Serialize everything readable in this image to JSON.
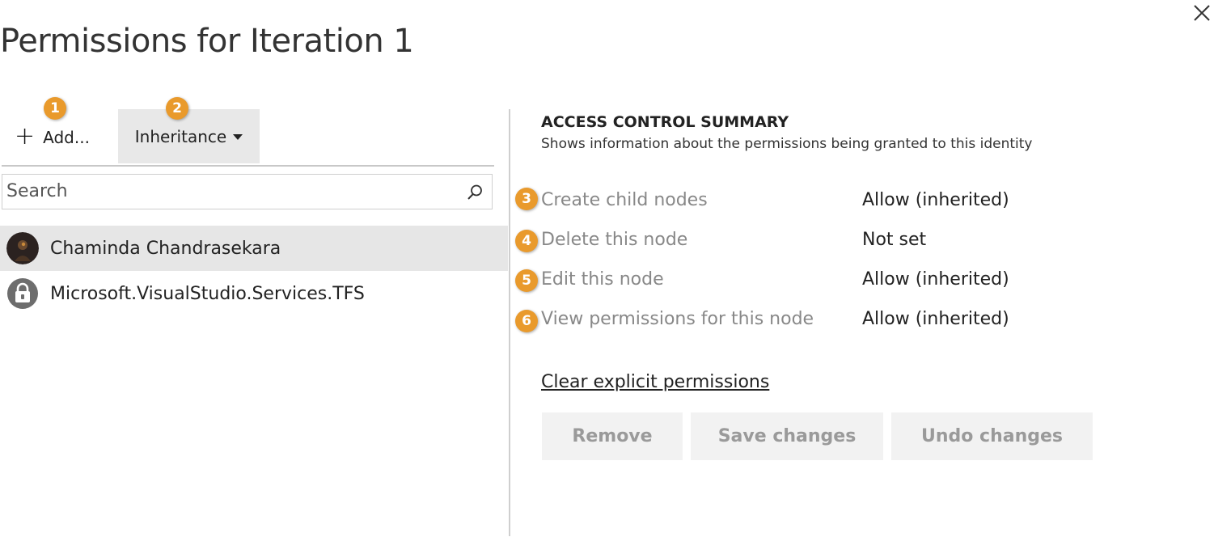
{
  "dialog": {
    "title": "Permissions for Iteration 1"
  },
  "toolbar": {
    "add_label": "Add...",
    "add_icon": "plus-icon",
    "inheritance_label": "Inheritance"
  },
  "search": {
    "placeholder": "Search",
    "value": ""
  },
  "identities": [
    {
      "name": "Chaminda Chandrasekara",
      "selected": true
    },
    {
      "name": "Microsoft.VisualStudio.Services.TFS",
      "selected": false
    }
  ],
  "summary": {
    "heading": "ACCESS CONTROL SUMMARY",
    "description": "Shows information about the permissions being granted to this identity",
    "permissions": [
      {
        "name": "Create child nodes",
        "value": "Allow (inherited)"
      },
      {
        "name": "Delete this node",
        "value": "Not set"
      },
      {
        "name": "Edit this node",
        "value": "Allow (inherited)"
      },
      {
        "name": "View permissions for this node",
        "value": "Allow (inherited)"
      }
    ],
    "clear_link": "Clear explicit permissions",
    "buttons": {
      "remove": "Remove",
      "save": "Save changes",
      "undo": "Undo changes"
    }
  },
  "callouts": [
    "1",
    "2",
    "3",
    "4",
    "5",
    "6"
  ],
  "colors": {
    "callout": "#e99a2c",
    "selected_row": "#e6e6e6",
    "muted_text": "#888888"
  }
}
